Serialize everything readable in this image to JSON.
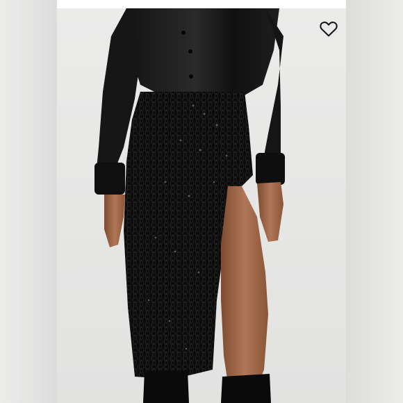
{
  "listing": {
    "photo": {
      "alt": "",
      "icon": "product-photo"
    },
    "like": {
      "icon": "heart-outline-icon",
      "liked": false
    }
  },
  "colors": {
    "background": "#ffffff",
    "side_panel": "#e3e3e2",
    "photo_backdrop": "#e8e8e7",
    "garment": "#0c0c0c",
    "skin": "#a2694a",
    "heart_stroke": "#111111"
  }
}
